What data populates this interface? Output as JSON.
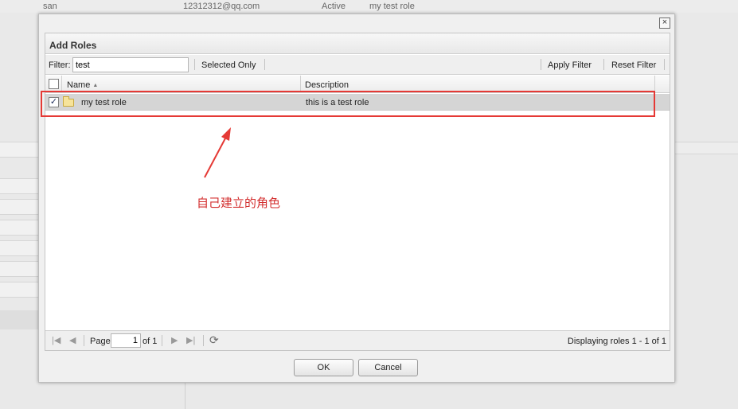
{
  "background": {
    "row": {
      "name": "san",
      "email": "12312312@qq.com",
      "status": "Active",
      "role": "my test role"
    }
  },
  "dialog": {
    "title": "Add Roles",
    "close_label": "×",
    "toolbar": {
      "filter_label": "Filter:",
      "filter_value": "test",
      "selected_only_label": "Selected Only",
      "apply_filter_label": "Apply Filter",
      "reset_filter_label": "Reset Filter"
    },
    "grid": {
      "columns": [
        {
          "label": "Name",
          "sort": "ascending"
        },
        {
          "label": "Description"
        }
      ],
      "rows": [
        {
          "checked": true,
          "name": "my test role",
          "description": "this is a test role"
        }
      ]
    },
    "pager": {
      "page_label": "Page",
      "page_value": "1",
      "of_label": "of 1",
      "display_text": "Displaying roles 1 - 1 of 1"
    },
    "buttons": {
      "ok_label": "OK",
      "cancel_label": "Cancel"
    }
  },
  "annotation": {
    "text": "自己建立的角色",
    "color": "#d32f2f"
  }
}
